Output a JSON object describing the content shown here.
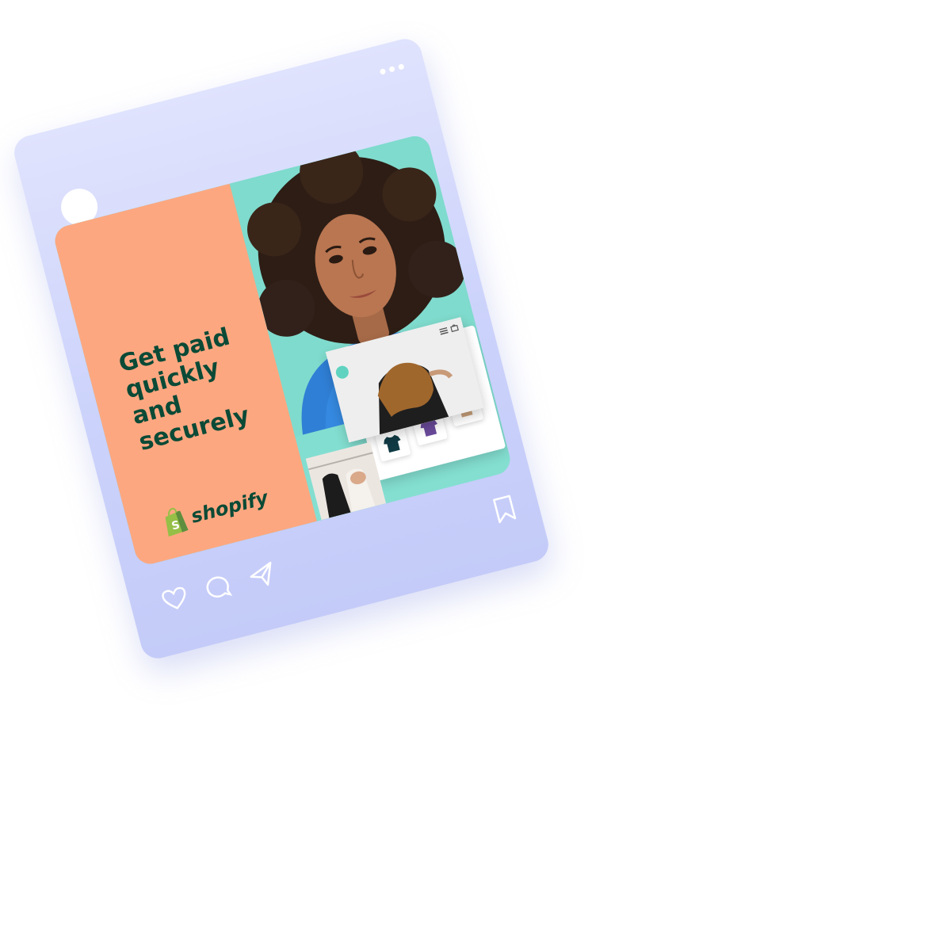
{
  "post": {
    "headline": "Get paid quickly and securely",
    "brand": "shopify"
  },
  "icons": {
    "avatar": "avatar-placeholder",
    "menu": "more-dots-icon",
    "like": "heart-icon",
    "comment": "comment-icon",
    "share": "send-icon",
    "save": "bookmark-icon"
  },
  "colors": {
    "card": "#cbd2fb",
    "panel": "#fda780",
    "headline": "#0b4a36",
    "teal": "#80dccf",
    "brand_green": "#95bf47"
  },
  "products": [
    "dark-tshirt",
    "purple-tshirt",
    "tan-tshirt"
  ]
}
